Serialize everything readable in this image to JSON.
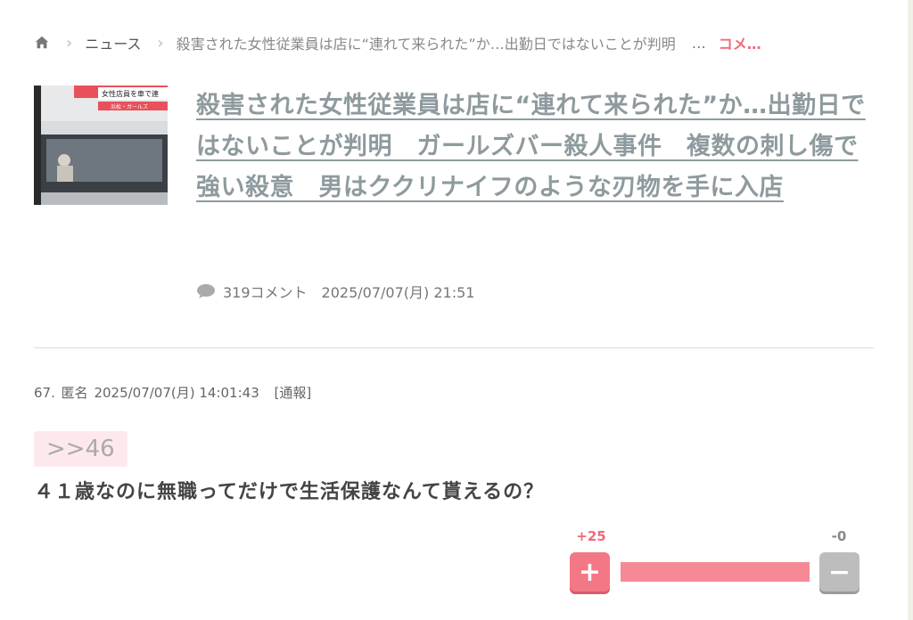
{
  "breadcrumb": {
    "home_icon": "home-icon",
    "news_label": "ニュース",
    "article_title": "殺害された女性従業員は店に“連れて来られた”か…出勤日ではないことが判明",
    "ellipsis": "…",
    "comment_label": "コメ…"
  },
  "article": {
    "title": "殺害された女性従業員は店に“連れて来られた”か…出勤日ではないことが判明　ガールズバー殺人事件　複数の刺し傷で強い殺意　男はククリナイフのような刃物を手に入店",
    "thumbnail_caption": "女性店員を車で連",
    "thumbnail_subcaption": "浜松・ガールズ",
    "comment_count": "319コメント",
    "date": "2025/07/07(月) 21:51"
  },
  "comment": {
    "number": "67.",
    "author": "匿名",
    "timestamp": "2025/07/07(月) 14:01:43",
    "report_label": "[通報]",
    "anchor": ">>46",
    "body": "４１歳なのに無職ってだけで生活保護なんて貰えるの？",
    "plus_count": "+25",
    "minus_count": "-0",
    "plus_label": "+",
    "minus_label": "−",
    "plus_ratio": 1.0
  },
  "colors": {
    "accent": "#f06a77",
    "title": "#8e9a9e",
    "plus_button": "#f37886",
    "minus_button": "#bdbdbd"
  }
}
